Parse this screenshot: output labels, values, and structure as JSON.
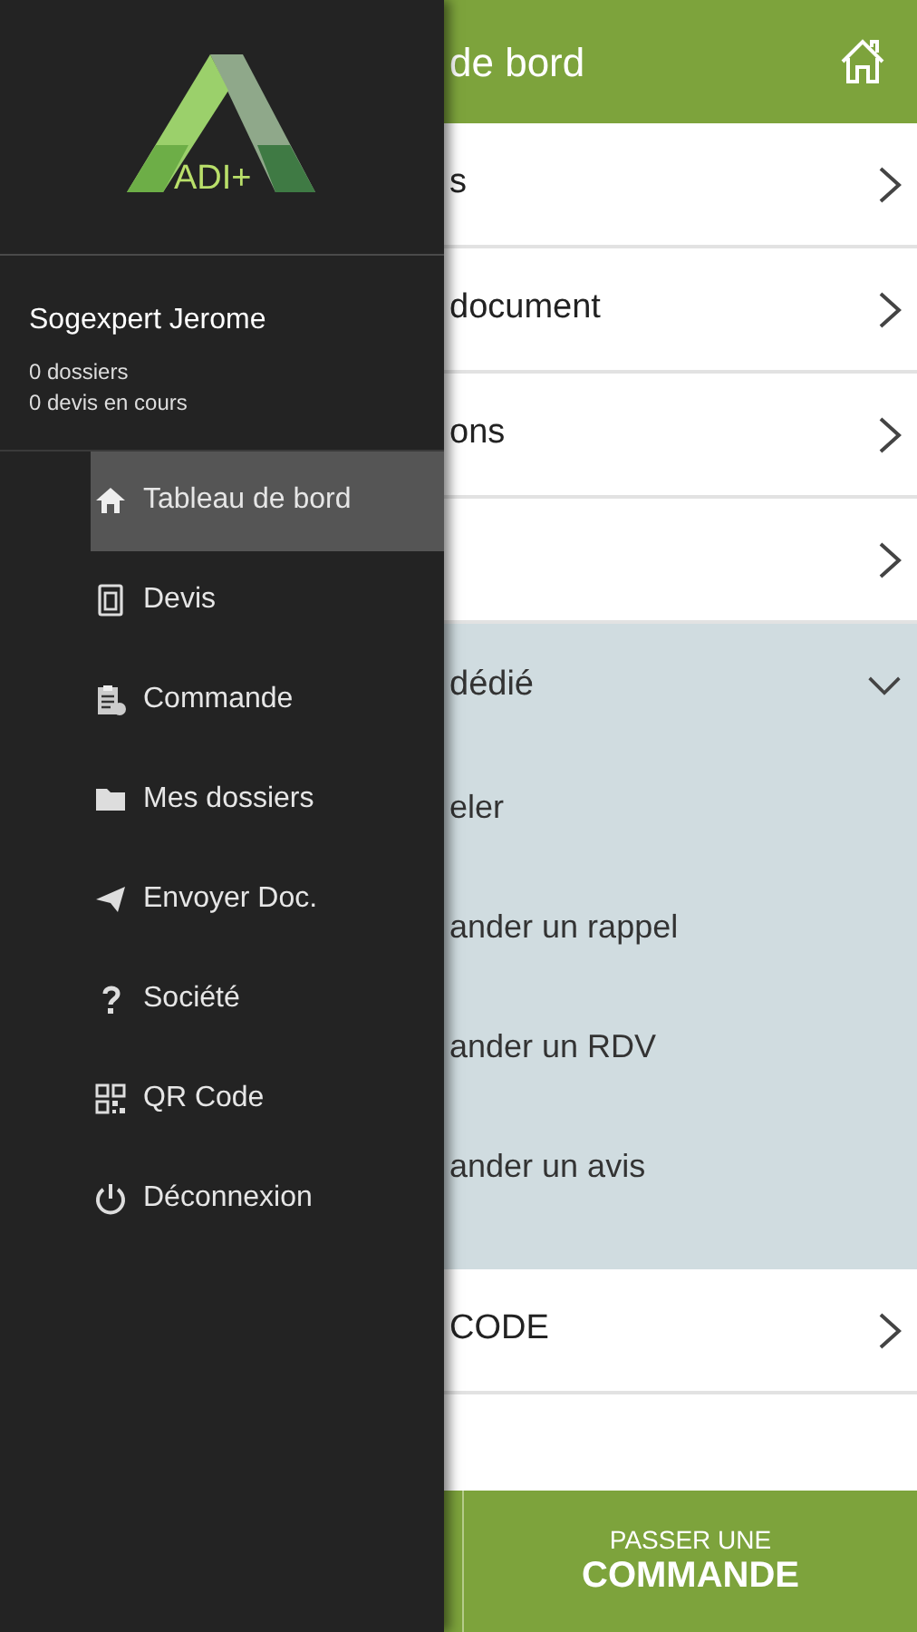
{
  "header": {
    "title": "de bord"
  },
  "rows": [
    {
      "kind": "link",
      "label": "s"
    },
    {
      "kind": "link",
      "label": "document"
    },
    {
      "kind": "link",
      "label": "ons"
    },
    {
      "kind": "link"
    },
    {
      "kind": "section",
      "label": "dédié",
      "expanded": true,
      "children": [
        {
          "label": "eler"
        },
        {
          "label": "ander un rappel"
        },
        {
          "label": "ander un RDV"
        },
        {
          "label": "ander un avis"
        }
      ]
    },
    {
      "kind": "link",
      "label": "CODE"
    }
  ],
  "order_button": {
    "line_1": "PASSER UNE",
    "line_2": "COMMANDE"
  },
  "drawer": {
    "logo": "ADI+",
    "user": {
      "name": "Sogexpert Jerome",
      "stats": [
        "0 dossiers",
        "0 devis en cours"
      ]
    },
    "menu": [
      {
        "label": "Tableau de bord",
        "selected": true
      },
      {
        "label": "Devis",
        "selected": false
      },
      {
        "label": "Commande",
        "selected": false
      },
      {
        "label": "Mes dossiers",
        "selected": false
      },
      {
        "label": "Envoyer Doc.",
        "selected": false
      },
      {
        "label": "Société",
        "selected": false
      },
      {
        "label": "QR Code",
        "selected": false
      },
      {
        "label": "Déconnexion",
        "selected": false
      }
    ]
  }
}
